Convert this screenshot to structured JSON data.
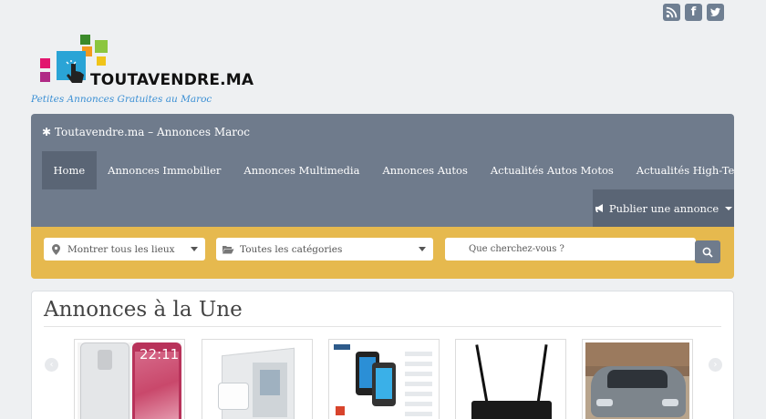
{
  "brand": {
    "logo_text": "TOUTAVENDRE.MA",
    "tagline": "Petites Annonces Gratuites au Maroc"
  },
  "social": [
    {
      "icon": "rss-icon"
    },
    {
      "icon": "facebook-icon",
      "glyph": "f"
    },
    {
      "icon": "twitter-icon"
    }
  ],
  "nav": {
    "site_title": "Toutavendre.ma – Annonces Maroc",
    "items": [
      {
        "label": "Home",
        "active": true
      },
      {
        "label": "Annonces Immobilier"
      },
      {
        "label": "Annonces Multimedia"
      },
      {
        "label": "Annonces Autos"
      },
      {
        "label": "Actualités Autos Motos"
      },
      {
        "label": "Actualités High-Tech"
      }
    ],
    "publish_label": "Publier une annonce"
  },
  "search": {
    "location_value": "Montrer tous les lieux",
    "category_value": "Toutes les catégories",
    "query_placeholder": "Que cherchez-vous ?"
  },
  "featured": {
    "title": "Annonces à la Une",
    "thumbs": [
      {
        "icon": "phone-image",
        "clock_text": "22:11"
      },
      {
        "icon": "router-box-image"
      },
      {
        "icon": "smartphone-promo-image"
      },
      {
        "icon": "wifi-router-image"
      },
      {
        "icon": "car-image"
      }
    ]
  },
  "colors": {
    "nav_bg": "#6f7b8c",
    "nav_active": "#5a6575",
    "search_bg": "#e6b94e",
    "tagline": "#3a8fd4"
  }
}
